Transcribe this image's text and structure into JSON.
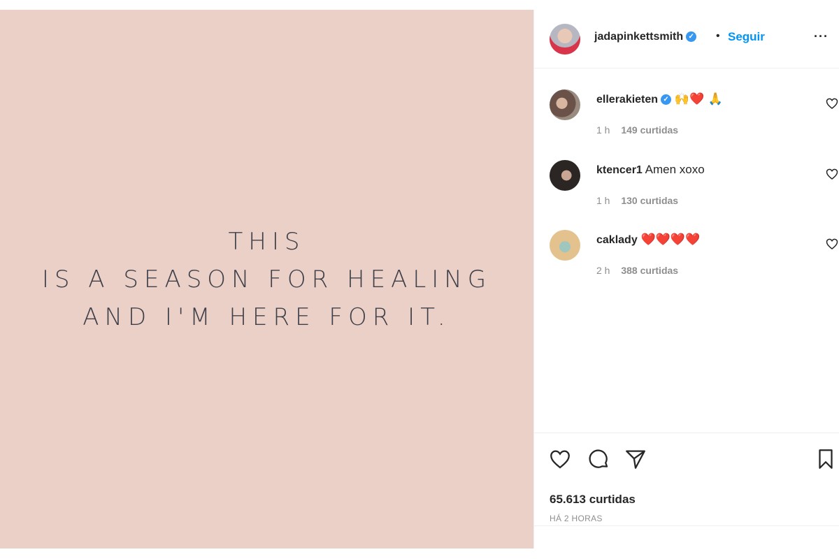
{
  "post": {
    "quote_lines": [
      "THIS",
      "IS A SEASON FOR HEALING",
      "AND I'M HERE FOR IT."
    ],
    "background_color": "#ead0c6"
  },
  "header": {
    "username": "jadapinkettsmith",
    "verified": true,
    "separator": "•",
    "follow_label": "Seguir",
    "more_label": "···"
  },
  "comments": [
    {
      "username": "ellerakieten",
      "verified": true,
      "text": "🙌❤️ 🙏",
      "time": "1 h",
      "likes": "149 curtidas"
    },
    {
      "username": "ktencer1",
      "verified": false,
      "text": "Amen xoxo",
      "time": "1 h",
      "likes": "130 curtidas"
    },
    {
      "username": "caklady",
      "verified": false,
      "text": "❤️❤️❤️❤️",
      "time": "2 h",
      "likes": "388 curtidas"
    }
  ],
  "actions": {
    "icons": [
      "heart-icon",
      "comment-icon",
      "share-icon",
      "bookmark-icon"
    ],
    "likes_total": "65.613 curtidas",
    "timestamp": "HÁ 2 HORAS"
  },
  "colors": {
    "accent": "#0095f6",
    "verified": "#3897f0",
    "heart": "#e0162b"
  }
}
